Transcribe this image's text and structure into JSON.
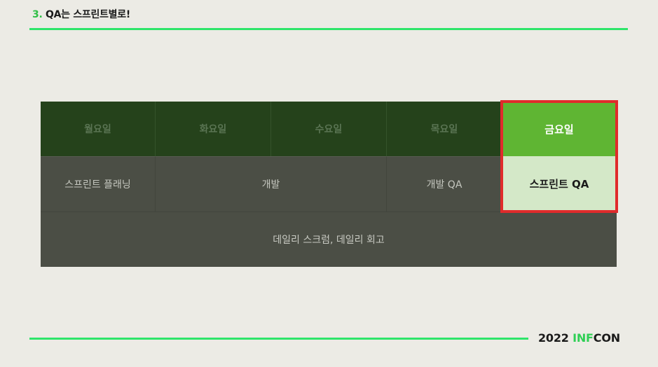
{
  "slide": {
    "title_number": "3.",
    "title_text": "QA는 스프린트별로!"
  },
  "schedule": {
    "days": [
      "월요일",
      "화요일",
      "수요일",
      "목요일",
      "금요일"
    ],
    "sprint_planning": "스프린트 플래닝",
    "development": "개발",
    "dev_qa": "개발 QA",
    "sprint_qa": "스프린트 QA",
    "daily": "데일리 스크럼, 데일리 회고",
    "highlight_color": "#e02b2b",
    "friday_color": "#5fb533"
  },
  "brand": {
    "year": "2022",
    "inf": "INF",
    "con": "CON"
  }
}
